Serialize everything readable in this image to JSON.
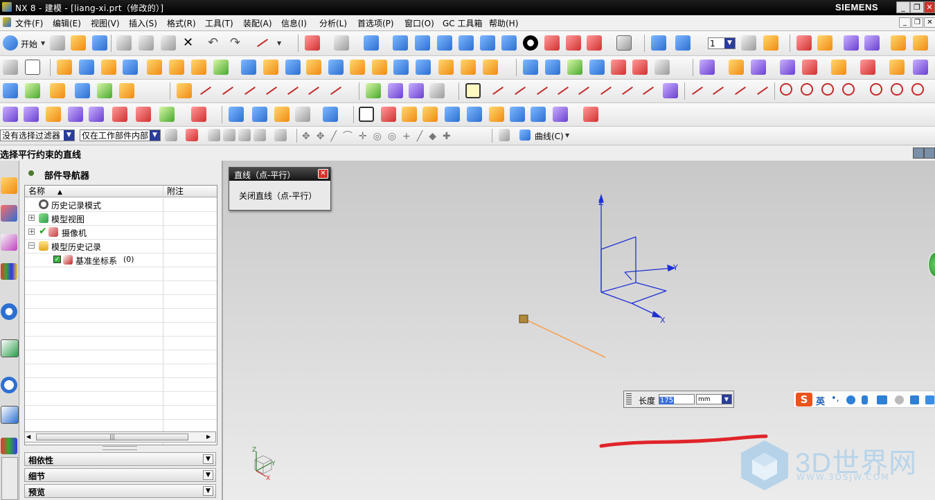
{
  "window": {
    "title": "NX 8 - 建模 - [liang-xi.prt（修改的）]",
    "brand": "SIEMENS",
    "controls": [
      "_",
      "❐",
      "✕"
    ]
  },
  "menubar": {
    "items": [
      "文件(F)",
      "编辑(E)",
      "视图(V)",
      "插入(S)",
      "格式(R)",
      "工具(T)",
      "装配(A)",
      "信息(I)",
      "分析(L)",
      "首选项(P)",
      "窗口(O)",
      "GC 工具箱",
      "帮助(H)"
    ],
    "start_label": "开始",
    "layer_value": "1"
  },
  "filter_bar": {
    "type_filter": "没有选择过滤器",
    "scope_filter": "仅在工作部件内部",
    "curve_menu": "曲线(C)"
  },
  "prompt": {
    "text": "选择平行约束的直线"
  },
  "navigator": {
    "title": "部件导航器",
    "columns": [
      "名称",
      "附注"
    ],
    "tree": [
      {
        "label": "历史记录模式",
        "note": "",
        "icon": "clock-icon"
      },
      {
        "label": "模型视图",
        "note": "",
        "icon": "model-view-icon"
      },
      {
        "label": "摄像机",
        "note": "",
        "icon": "camera-icon"
      },
      {
        "label": "模型历史记录",
        "note": "",
        "icon": "folder-icon"
      },
      {
        "label": "基准坐标系",
        "suffix": "(0)",
        "note": "",
        "icon": "datum-csys-icon"
      }
    ],
    "panels": [
      "相依性",
      "细节",
      "预览"
    ]
  },
  "dialog": {
    "title": "直线（点-平行）",
    "option": "关闭直线（点-平行）"
  },
  "length_input": {
    "label": "长度",
    "value": "175",
    "unit": "mm"
  },
  "ime": {
    "logo": "S",
    "mode": "英"
  },
  "axes": {
    "z": "Z",
    "y": "Y",
    "x": "X"
  },
  "watermark": {
    "text": "3D世界网",
    "url": "WWW.3DSJW.COM"
  },
  "colors": {
    "csys": "#1e2fd6",
    "line": "#f5a050",
    "annotation": "#e0242a",
    "triad_z": "#2a7a2a",
    "triad_y": "#2a7a2a",
    "triad_x": "#d02a2a"
  }
}
